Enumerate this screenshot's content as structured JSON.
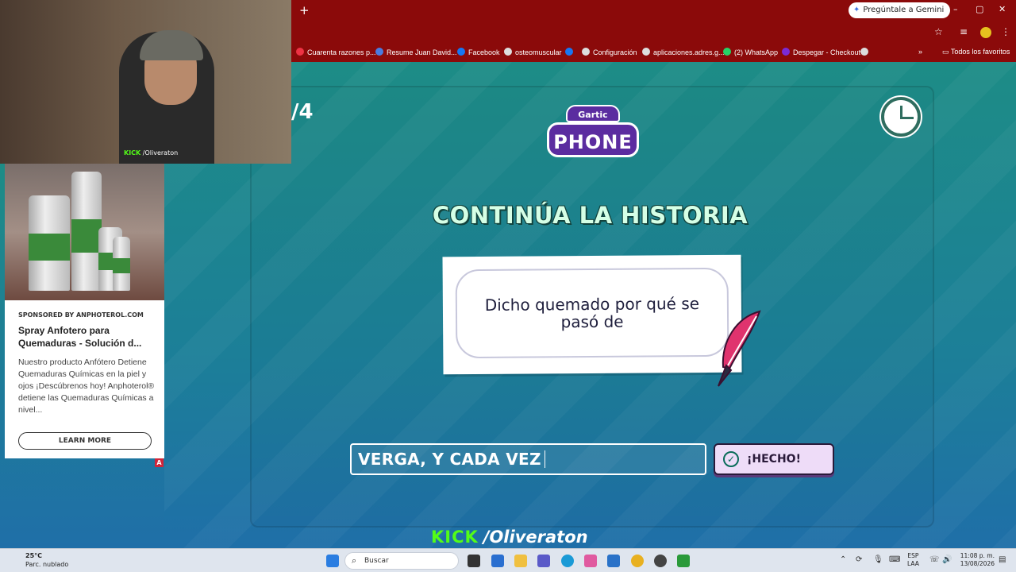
{
  "browser": {
    "new_tab_symbol": "+",
    "gemini_button": "Pregúntale a Gemini",
    "window_controls": [
      "–",
      "▢",
      "✕"
    ],
    "bookmarks": [
      {
        "label": "Cuarenta razones p...",
        "icon_color": "#e34"
      },
      {
        "label": "Resume Juan David...",
        "icon_color": "#4a7be0"
      },
      {
        "label": "Facebook",
        "icon_color": "#1877f2"
      },
      {
        "label": "osteomuscular",
        "icon_color": "#ddd"
      },
      {
        "label": "",
        "icon_color": "#1877f2"
      },
      {
        "label": "Configuración",
        "icon_color": "#ddd"
      },
      {
        "label": "aplicaciones.adres.g...",
        "icon_color": "#ddd"
      },
      {
        "label": "(2) WhatsApp",
        "icon_color": "#25d366"
      },
      {
        "label": "Despegar - Checkout",
        "icon_color": "#7b2bd6"
      },
      {
        "label": "",
        "icon_color": "#ddd"
      }
    ],
    "bookmarks_overflow": "»",
    "all_bookmarks": "Todos los favoritos"
  },
  "webcam": {
    "kick_label": "KICK",
    "username": "/Oliveraton"
  },
  "ad": {
    "sponsor": "SPONSORED BY ANPHOTEROL.COM",
    "title": "Spray Anfotero para Quemaduras - Solución d...",
    "body": "Nuestro producto Anfótero Detiene Quemaduras Químicas en la piel y ojos ¡Descúbrenos hoy! Anphoterol® detiene las Quemaduras Químicas a nivel...",
    "cta": "LEARN MORE",
    "badge": "A"
  },
  "game": {
    "round": "/4",
    "logo_top": "Gartic",
    "logo_bottom": "PHONE",
    "title": "CONTINÚA LA HISTORIA",
    "prompt": "Dicho quemado por qué se pasó de",
    "answer_value": "VERGA, Y CADA VEZ",
    "done_label": "¡HECHO!",
    "overlay_kick": "KICK",
    "overlay_user": "/Oliveraton"
  },
  "taskbar": {
    "weather_temp": "25°C",
    "weather_desc": "Parc. nublado",
    "search_placeholder": "Buscar",
    "lang_top": "ESP",
    "lang_bottom": "LAA",
    "time": "11:08 p. m.",
    "date": "13/08/2026"
  },
  "colors": {
    "chrome": "#8b0a0a",
    "game_bg": "#1c7f98",
    "title": "#d5ffe6",
    "kick": "#53fc18"
  }
}
